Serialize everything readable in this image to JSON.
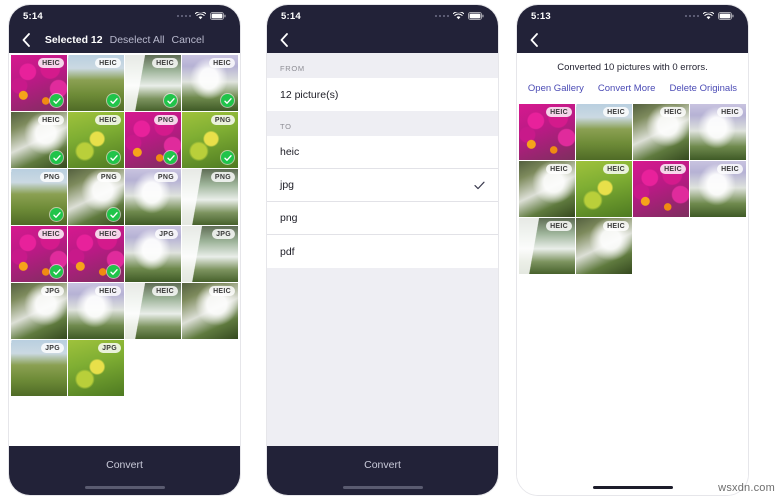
{
  "meta": {
    "watermark": "wsxdn.com"
  },
  "phones": [
    {
      "id": "selection",
      "status": {
        "time": "5:14",
        "wifi_icon": "wifi-icon",
        "battery_icon": "battery-icon",
        "signal_icon": "signal-dots-icon"
      },
      "nav": {
        "back_icon": "chevron-left-icon",
        "title": "Selected 12",
        "deselect_label": "Deselect All",
        "cancel_label": "Cancel"
      },
      "grid": [
        {
          "badge": "HEIC",
          "selected": true,
          "art": "flowers-pink"
        },
        {
          "badge": "HEIC",
          "selected": true,
          "art": "field-wires"
        },
        {
          "badge": "HEIC",
          "selected": true,
          "art": "waterfall-tall"
        },
        {
          "badge": "HEIC",
          "selected": true,
          "art": "waterfall-wide"
        },
        {
          "badge": "HEIC",
          "selected": true,
          "art": "waterfall-mossy"
        },
        {
          "badge": "HEIC",
          "selected": true,
          "art": "leaf-yellow"
        },
        {
          "badge": "PNG",
          "selected": true,
          "art": "flowers-pink"
        },
        {
          "badge": "PNG",
          "selected": true,
          "art": "leaf-yellow"
        },
        {
          "badge": "PNG",
          "selected": true,
          "art": "field-wires"
        },
        {
          "badge": "PNG",
          "selected": true,
          "art": "waterfall-mossy"
        },
        {
          "badge": "PNG",
          "selected": false,
          "art": "waterfall-wide"
        },
        {
          "badge": "PNG",
          "selected": false,
          "art": "waterfall-tall"
        },
        {
          "badge": "HEIC",
          "selected": true,
          "art": "flowers-pink"
        },
        {
          "badge": "HEIC",
          "selected": true,
          "art": "flowers-pink"
        },
        {
          "badge": "JPG",
          "selected": false,
          "art": "waterfall-wide"
        },
        {
          "badge": "JPG",
          "selected": false,
          "art": "waterfall-tall"
        },
        {
          "badge": "JPG",
          "selected": false,
          "art": "waterfall-mossy"
        },
        {
          "badge": "HEIC",
          "selected": false,
          "art": "waterfall-wide"
        },
        {
          "badge": "HEIC",
          "selected": false,
          "art": "waterfall-tall"
        },
        {
          "badge": "HEIC",
          "selected": false,
          "art": "waterfall-mossy"
        },
        {
          "badge": "JPG",
          "selected": false,
          "art": "field-wires"
        },
        {
          "badge": "JPG",
          "selected": false,
          "art": "leaf-yellow"
        }
      ],
      "bottom": {
        "convert_label": "Convert"
      }
    },
    {
      "id": "format",
      "status": {
        "time": "5:14",
        "wifi_icon": "wifi-icon",
        "battery_icon": "battery-icon",
        "signal_icon": "signal-dots-icon"
      },
      "nav": {
        "back_icon": "chevron-left-icon"
      },
      "sections": [
        {
          "header": "FROM",
          "rows": [
            {
              "label": "12 picture(s)",
              "checked": false
            }
          ]
        },
        {
          "header": "TO",
          "rows": [
            {
              "label": "heic",
              "checked": false
            },
            {
              "label": "jpg",
              "checked": true
            },
            {
              "label": "png",
              "checked": false
            },
            {
              "label": "pdf",
              "checked": false
            }
          ]
        }
      ],
      "bottom": {
        "convert_label": "Convert"
      }
    },
    {
      "id": "result",
      "status": {
        "time": "5:13",
        "wifi_icon": "wifi-icon",
        "battery_icon": "battery-icon",
        "signal_icon": "signal-dots-icon"
      },
      "nav": {
        "back_icon": "chevron-left-icon"
      },
      "result": {
        "message": "Converted 10 pictures with 0 errors.",
        "actions": [
          {
            "label": "Open Gallery"
          },
          {
            "label": "Convert More"
          },
          {
            "label": "Delete Originals"
          }
        ]
      },
      "grid": [
        {
          "badge": "HEIC",
          "selected": false,
          "art": "flowers-pink"
        },
        {
          "badge": "HEIC",
          "selected": false,
          "art": "field-wires"
        },
        {
          "badge": "HEIC",
          "selected": false,
          "art": "waterfall-mossy"
        },
        {
          "badge": "HEIC",
          "selected": false,
          "art": "waterfall-wide"
        },
        {
          "badge": "HEIC",
          "selected": false,
          "art": "waterfall-mossy"
        },
        {
          "badge": "HEIC",
          "selected": false,
          "art": "leaf-yellow"
        },
        {
          "badge": "HEIC",
          "selected": false,
          "art": "flowers-pink"
        },
        {
          "badge": "HEIC",
          "selected": false,
          "art": "waterfall-wide"
        },
        {
          "badge": "HEIC",
          "selected": false,
          "art": "waterfall-tall"
        },
        {
          "badge": "HEIC",
          "selected": false,
          "art": "waterfall-mossy"
        }
      ]
    }
  ],
  "colors": {
    "nav_bg": "#222238",
    "accent_link": "#4b4bb5",
    "tick_green": "#20c44a",
    "list_bg": "#eeeef3"
  }
}
